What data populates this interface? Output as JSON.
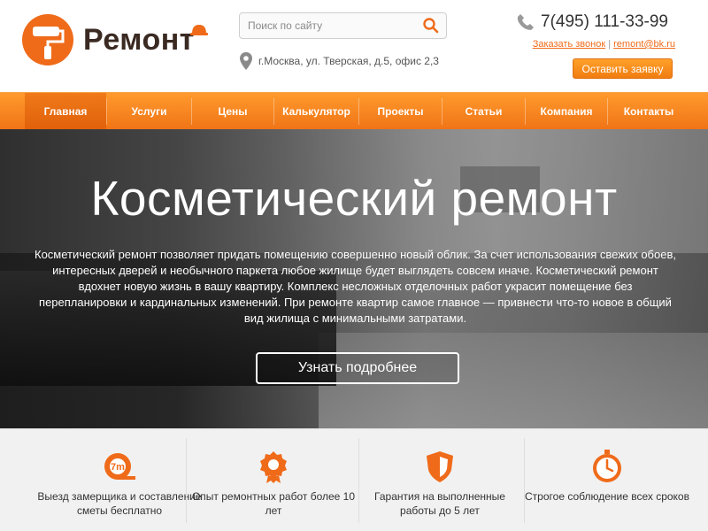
{
  "header": {
    "logo_text": "Ремонт",
    "search": {
      "placeholder": "Поиск по сайту"
    },
    "address": "г.Москва, ул. Тверская, д.5, офис 2,3",
    "phone": "7(495) 111-33-99",
    "callback_link": "Заказать звонок",
    "separator": "|",
    "email": "remont@bk.ru",
    "cta_button": "Оставить заявку"
  },
  "nav": {
    "items": [
      {
        "label": "Главная",
        "active": true
      },
      {
        "label": "Услуги"
      },
      {
        "label": "Цены"
      },
      {
        "label": "Калькулятор"
      },
      {
        "label": "Проекты"
      },
      {
        "label": "Статьи"
      },
      {
        "label": "Компания"
      },
      {
        "label": "Контакты"
      }
    ]
  },
  "hero": {
    "title": "Косметический ремонт",
    "text": "Косметический ремонт позволяет придать помещению совершенно новый облик. За счет использования свежих обоев, интересных дверей и необычного паркета любое жилище будет выглядеть совсем иначе. Косметический ремонт вдохнет новую жизнь в вашу квартиру. Комплекс несложных отделочных работ украсит помещение без перепланировки и кардинальных изменений. При ремонте квартир самое главное — привнести что-то новое в общий вид жилища с минимальными затратами.",
    "button": "Узнать подробнее"
  },
  "features": [
    {
      "icon": "tape-measure-icon",
      "label": "Выезд замерщика и составление сметы бесплатно"
    },
    {
      "icon": "award-medal-icon",
      "label": "Опыт ремонтных работ более 10 лет"
    },
    {
      "icon": "shield-icon",
      "label": "Гарантия на выполненные работы до 5 лет"
    },
    {
      "icon": "stopwatch-icon",
      "label": "Строгое соблюдение всех сроков"
    }
  ],
  "colors": {
    "accent": "#ef6b1a",
    "nav_top": "#ff9a2e",
    "nav_bottom": "#f07416",
    "logo_text": "#3a2a22"
  }
}
